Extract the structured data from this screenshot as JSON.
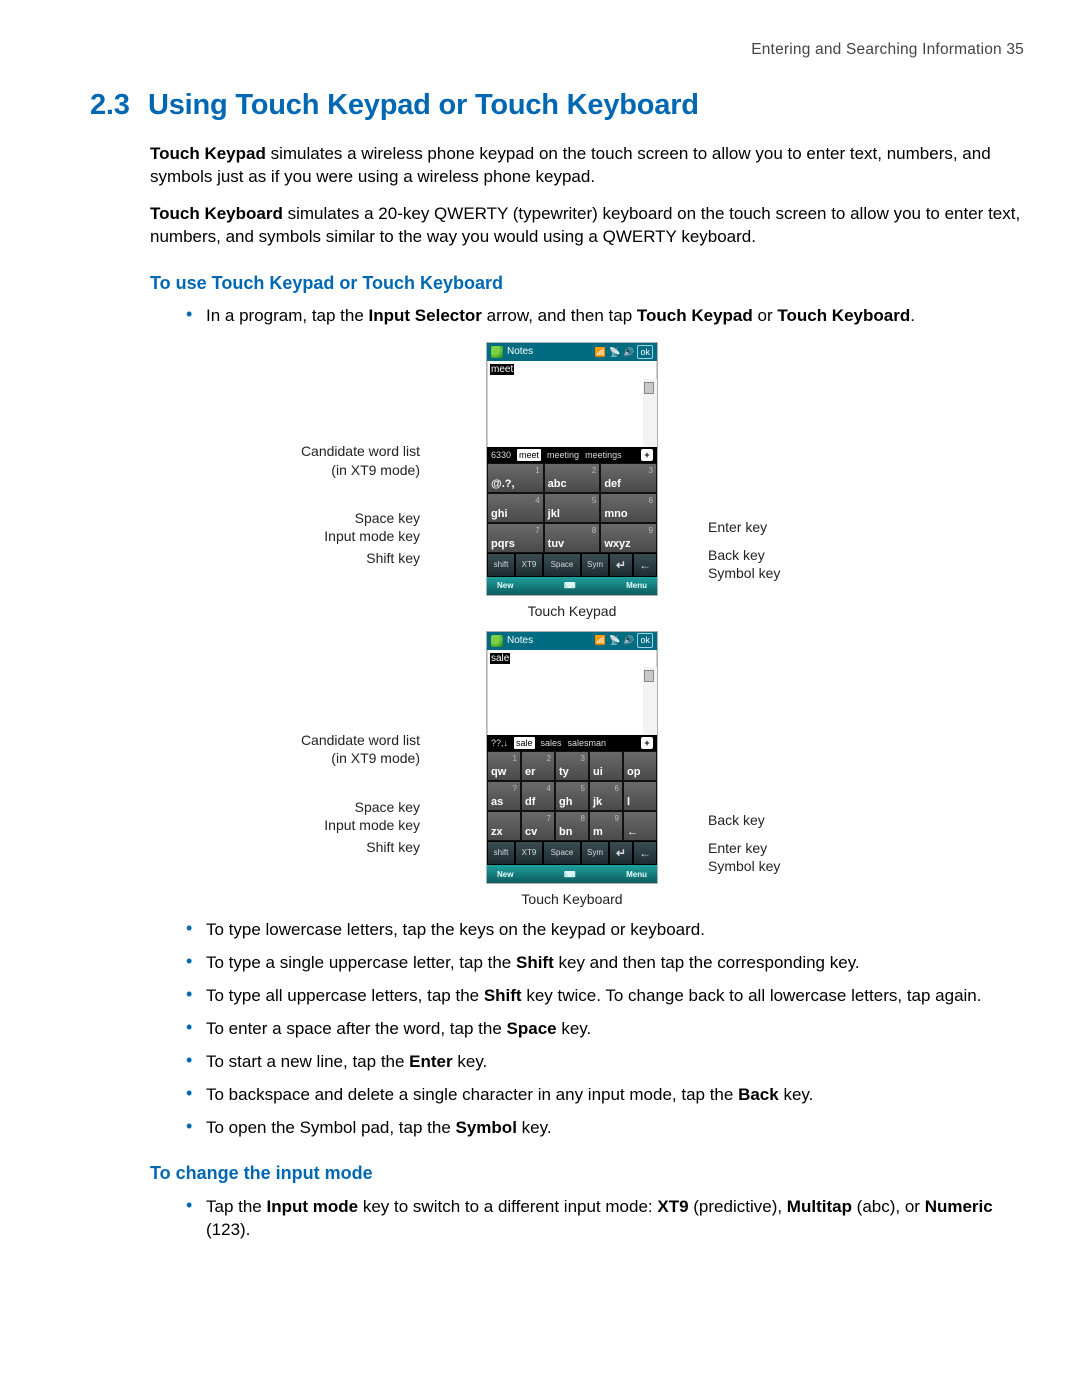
{
  "runningHead": "Entering and Searching Information  35",
  "section": {
    "number": "2.3",
    "title": "Using Touch Keypad or Touch Keyboard"
  },
  "intro1_a": "Touch Keypad",
  "intro1_b": " simulates a wireless phone keypad on the touch screen to allow you to enter text, numbers, and symbols just as if you were using a wireless phone keypad.",
  "intro2_a": "Touch Keyboard",
  "intro2_b": " simulates a 20-key QWERTY (typewriter) keyboard on the touch screen to allow you to enter text, numbers, and symbols similar to the way you would using a QWERTY keyboard.",
  "sub1": "To use Touch Keypad or Touch Keyboard",
  "bullet1_pre": "In a program, tap the ",
  "bullet1_b1": "Input Selector",
  "bullet1_mid": " arrow, and then tap ",
  "bullet1_b2": "Touch Keypad",
  "bullet1_or": " or ",
  "bullet1_b3": "Touch Keyboard",
  "period": ".",
  "fig1": {
    "notesTitle": "Notes",
    "ok": "ok",
    "typed": "meet",
    "cand_ct": "6330",
    "cand_sel": "meet",
    "cand_rest": [
      "meeting",
      "meetings"
    ],
    "keys": [
      {
        "label": "@.?,",
        "num": "1"
      },
      {
        "label": "abc",
        "num": "2"
      },
      {
        "label": "def",
        "num": "3"
      },
      {
        "label": "ghi",
        "num": "4"
      },
      {
        "label": "jkl",
        "num": "5"
      },
      {
        "label": "mno",
        "num": "6"
      },
      {
        "label": "pqrs",
        "num": "7"
      },
      {
        "label": "tuv",
        "num": "8"
      },
      {
        "label": "wxyz",
        "num": "9"
      }
    ],
    "bottom": [
      "shift",
      "XT9",
      "Space",
      "Sym",
      "↵",
      "←"
    ],
    "footL": "New",
    "footR": "Menu",
    "caption": "Touch Keypad",
    "leftCallouts": [
      "Candidate word list\n(in XT9 mode)",
      "Space key",
      "Input mode key",
      "Shift key"
    ],
    "rightCallouts": [
      "Enter key",
      "Back key",
      "Symbol key"
    ]
  },
  "fig2": {
    "notesTitle": "Notes",
    "ok": "ok",
    "typed": "sale",
    "cand_ct": "??,↓",
    "cand_sel": "sale",
    "cand_rest": [
      "sales",
      "salesman"
    ],
    "keys": [
      {
        "label": "qw",
        "num": "1"
      },
      {
        "label": "er",
        "num": "2"
      },
      {
        "label": "ty",
        "num": "3"
      },
      {
        "label": "ui",
        "num": ""
      },
      {
        "label": "op",
        "num": ""
      },
      {
        "label": "as",
        "num": "?"
      },
      {
        "label": "df",
        "num": "4"
      },
      {
        "label": "gh",
        "num": "5"
      },
      {
        "label": "jk",
        "num": "6"
      },
      {
        "label": "l",
        "num": ""
      },
      {
        "label": "zx",
        "num": ""
      },
      {
        "label": "cv",
        "num": "7"
      },
      {
        "label": "bn",
        "num": "8"
      },
      {
        "label": "m",
        "num": "9"
      },
      {
        "label": "←",
        "num": ""
      }
    ],
    "bottom": [
      "shift",
      "XT9",
      "Space",
      "Sym",
      "↵",
      "←"
    ],
    "footL": "New",
    "footR": "Menu",
    "caption": "Touch Keyboard",
    "leftCallouts": [
      "Candidate word list\n(in XT9 mode)",
      "Space key",
      "Input mode key",
      "Shift key"
    ],
    "rightCallouts": [
      "Back key",
      "Enter key",
      "Symbol key"
    ]
  },
  "bulletsA": [
    "To type lowercase letters, tap the keys on the keypad or keyboard."
  ],
  "bulletB_pre": "To type a single uppercase letter, tap the ",
  "bulletB_b": "Shift",
  "bulletB_post": " key and then tap the corresponding key.",
  "bulletC_pre": "To type all uppercase letters, tap the ",
  "bulletC_b": "Shift",
  "bulletC_post": " key twice. To change back to all lowercase letters, tap again.",
  "bulletD_pre": "To enter a space after the word, tap the ",
  "bulletD_b": "Space",
  "bulletD_post": " key.",
  "bulletE_pre": "To start a new line, tap the ",
  "bulletE_b": "Enter",
  "bulletE_post": " key.",
  "bulletF_pre": "To backspace and delete a single character in any input mode, tap the ",
  "bulletF_b": "Back",
  "bulletF_post": " key.",
  "bulletG_pre": "To open the Symbol pad, tap the ",
  "bulletG_b": "Symbol",
  "bulletG_post": " key.",
  "sub2": "To change the input mode",
  "mode_pre": "Tap the ",
  "mode_b1": "Input mode",
  "mode_mid": " key to switch to a different input mode: ",
  "mode_b2": "XT9",
  "mode_p1": " (predictive), ",
  "mode_b3": "Multitap",
  "mode_p2": " (abc), or ",
  "mode_b4": "Numeric",
  "mode_p3": " (123)."
}
